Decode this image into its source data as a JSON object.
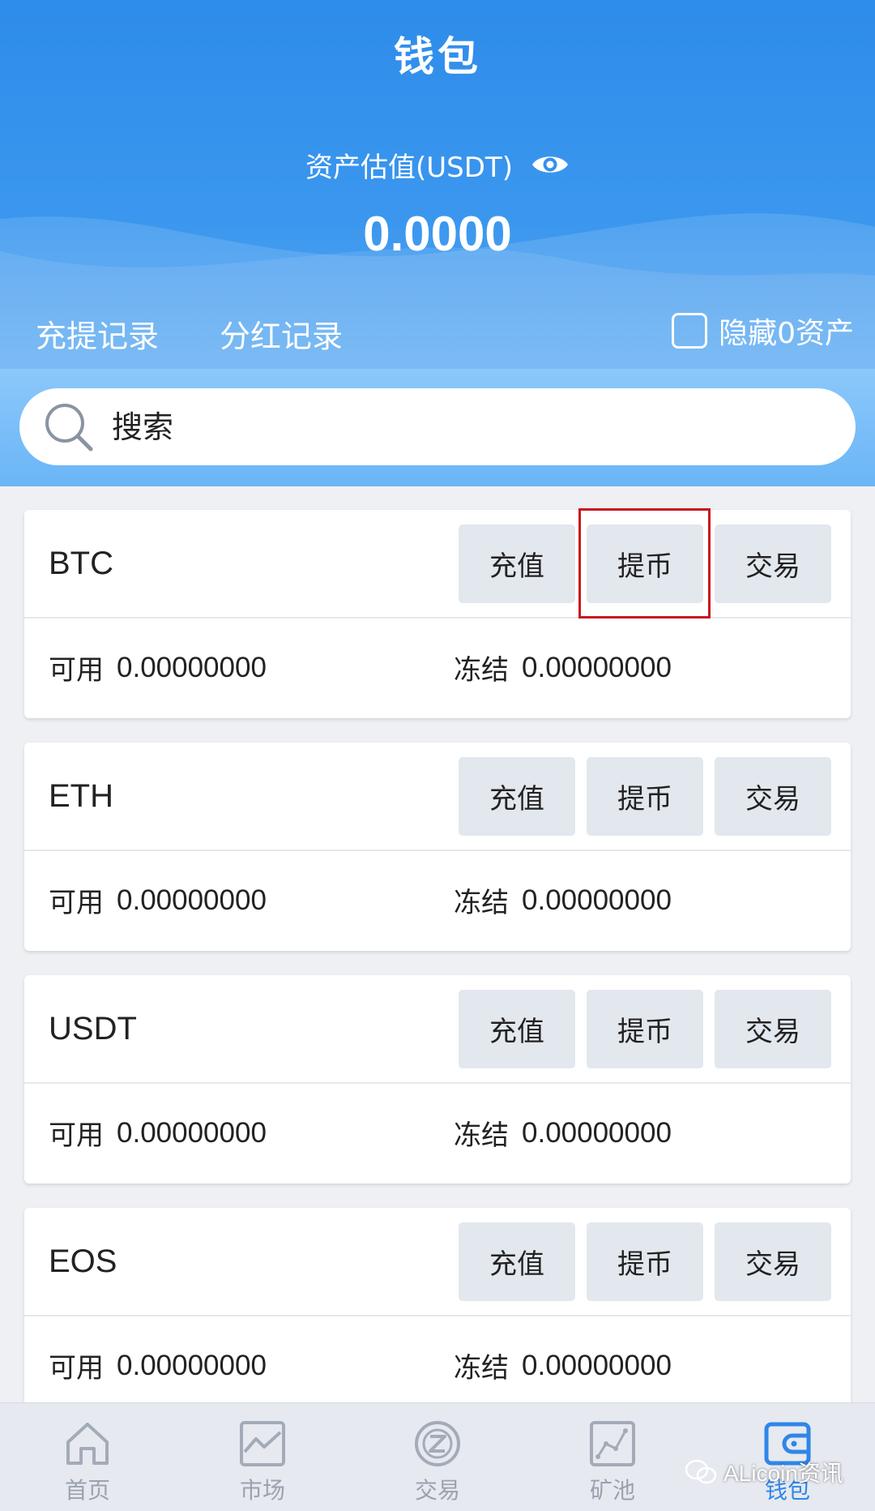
{
  "header": {
    "title": "钱包",
    "asset_label": "资产估值(USDT)",
    "asset_value": "0.0000",
    "eye_icon": "eye-icon",
    "records": [
      "充提记录",
      "分红记录"
    ],
    "hide_zero_label": "隐藏0资产",
    "hide_zero_checked": false
  },
  "search": {
    "placeholder": "搜索",
    "icon": "search-icon"
  },
  "coins": [
    {
      "name": "BTC",
      "avail_label": "可用",
      "avail": "0.00000000",
      "frozen_label": "冻结",
      "frozen": "0.00000000"
    },
    {
      "name": "ETH",
      "avail_label": "可用",
      "avail": "0.00000000",
      "frozen_label": "冻结",
      "frozen": "0.00000000"
    },
    {
      "name": "USDT",
      "avail_label": "可用",
      "avail": "0.00000000",
      "frozen_label": "冻结",
      "frozen": "0.00000000"
    },
    {
      "name": "EOS",
      "avail_label": "可用",
      "avail": "0.00000000",
      "frozen_label": "冻结",
      "frozen": "0.00000000"
    }
  ],
  "actions": {
    "deposit": "充值",
    "withdraw": "提币",
    "trade": "交易"
  },
  "nav": [
    {
      "label": "首页",
      "icon": "home-icon"
    },
    {
      "label": "市场",
      "icon": "chart-icon"
    },
    {
      "label": "交易",
      "icon": "trade-icon"
    },
    {
      "label": "矿池",
      "icon": "mining-icon"
    },
    {
      "label": "钱包",
      "icon": "wallet-icon",
      "active": true
    }
  ],
  "watermark": "ALicoin资讯",
  "colors": {
    "primary": "#2e8cea",
    "nav_active": "#2f86e8",
    "nav_inactive": "#9aa2b0",
    "button_bg": "#e3e7ee",
    "highlight": "#c8161d"
  }
}
